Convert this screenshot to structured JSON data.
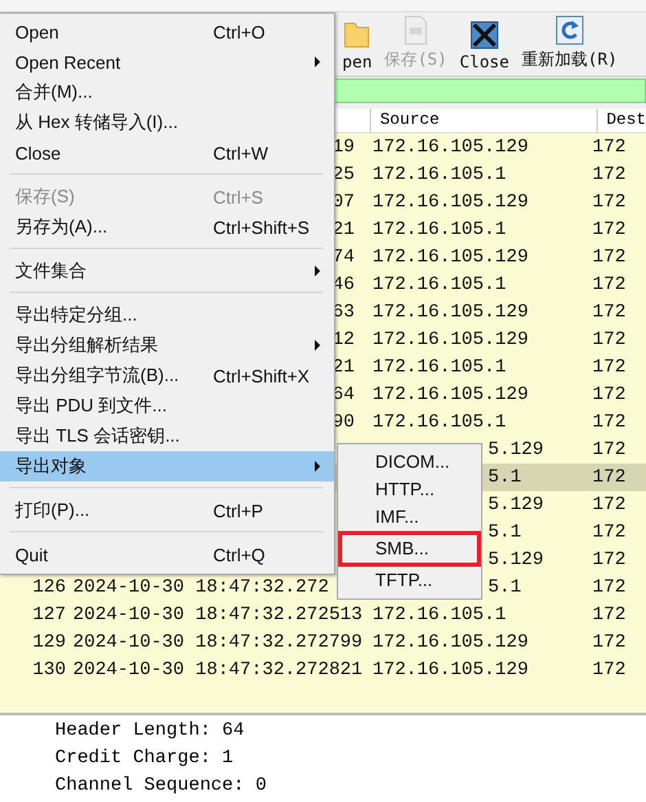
{
  "toolbar": {
    "buttons": [
      {
        "kind": "folder",
        "label": "pen",
        "disabled": false
      },
      {
        "kind": "save",
        "label": "保存(S)",
        "disabled": true
      },
      {
        "kind": "close",
        "label": "Close",
        "disabled": false
      },
      {
        "kind": "reload",
        "label": "重新加载(R)",
        "disabled": false
      }
    ]
  },
  "packet_list": {
    "columns": [
      "Source",
      "Dest"
    ],
    "rows": [
      {
        "kind": "tail",
        "time": "19",
        "source": "172.16.105.129",
        "destination": "172",
        "selected": false
      },
      {
        "kind": "tail",
        "time": "25",
        "source": "172.16.105.1",
        "destination": "172",
        "selected": false
      },
      {
        "kind": "tail",
        "time": "07",
        "source": "172.16.105.129",
        "destination": "172",
        "selected": false
      },
      {
        "kind": "tail",
        "time": "21",
        "source": "172.16.105.1",
        "destination": "172",
        "selected": false
      },
      {
        "kind": "tail",
        "time": "74",
        "source": "172.16.105.129",
        "destination": "172",
        "selected": false
      },
      {
        "kind": "tail",
        "time": "46",
        "source": "172.16.105.1",
        "destination": "172",
        "selected": false
      },
      {
        "kind": "tail",
        "time": "63",
        "source": "172.16.105.129",
        "destination": "172",
        "selected": false
      },
      {
        "kind": "tail",
        "time": "12",
        "source": "172.16.105.129",
        "destination": "172",
        "selected": false
      },
      {
        "kind": "tail",
        "time": "21",
        "source": "172.16.105.1",
        "destination": "172",
        "selected": false
      },
      {
        "kind": "tail",
        "time": "64",
        "source": "172.16.105.129",
        "destination": "172",
        "selected": false
      },
      {
        "kind": "tail",
        "time": "90",
        "source": "172.16.105.1",
        "destination": "172",
        "selected": false
      },
      {
        "kind": "covered",
        "source": "5.129",
        "destination": "172",
        "selected": false
      },
      {
        "kind": "covered",
        "source": "5.1",
        "destination": "172",
        "selected": true
      },
      {
        "kind": "covered",
        "source": "5.129",
        "destination": "172",
        "selected": false
      },
      {
        "kind": "covered",
        "source": "5.1",
        "destination": "172",
        "selected": false
      },
      {
        "kind": "covered",
        "source": "5.129",
        "destination": "172",
        "selected": false
      },
      {
        "kind": "partial",
        "number": "126",
        "time": "2024-10-30 18:47:32.272",
        "source": "5.1",
        "destination": "172",
        "selected": false
      },
      {
        "kind": "full",
        "number": "127",
        "time": "2024-10-30 18:47:32.272513",
        "source": "172.16.105.1",
        "destination": "172",
        "selected": false
      },
      {
        "kind": "full",
        "number": "129",
        "time": "2024-10-30 18:47:32.272799",
        "source": "172.16.105.129",
        "destination": "172",
        "selected": false
      },
      {
        "kind": "full",
        "number": "130",
        "time": "2024-10-30 18:47:32.272821",
        "source": "172.16.105.129",
        "destination": "172",
        "selected": false
      }
    ]
  },
  "details": {
    "lines": [
      "Header Length: 64",
      "Credit Charge: 1",
      "Channel Sequence: 0"
    ]
  },
  "file_menu": {
    "items": [
      {
        "kind": "item",
        "label": "Open",
        "shortcut": "Ctrl+O",
        "submenu": false,
        "disabled": false,
        "selected": false
      },
      {
        "kind": "item",
        "label": "Open Recent",
        "submenu": true,
        "disabled": false,
        "selected": false
      },
      {
        "kind": "item",
        "label": "合并(M)...",
        "submenu": false,
        "disabled": false,
        "selected": false
      },
      {
        "kind": "item",
        "label": "从 Hex 转储导入(I)...",
        "submenu": false,
        "disabled": false,
        "selected": false
      },
      {
        "kind": "item",
        "label": "Close",
        "shortcut": "Ctrl+W",
        "submenu": false,
        "disabled": false,
        "selected": false
      },
      {
        "kind": "separator"
      },
      {
        "kind": "item",
        "label": "保存(S)",
        "shortcut": "Ctrl+S",
        "submenu": false,
        "disabled": true,
        "selected": false
      },
      {
        "kind": "item",
        "label": "另存为(A)...",
        "shortcut": "Ctrl+Shift+S",
        "submenu": false,
        "disabled": false,
        "selected": false
      },
      {
        "kind": "separator"
      },
      {
        "kind": "item",
        "label": "文件集合",
        "submenu": true,
        "disabled": false,
        "selected": false
      },
      {
        "kind": "separator"
      },
      {
        "kind": "item",
        "label": "导出特定分组...",
        "submenu": false,
        "disabled": false,
        "selected": false
      },
      {
        "kind": "item",
        "label": "导出分组解析结果",
        "submenu": true,
        "disabled": false,
        "selected": false
      },
      {
        "kind": "item",
        "label": "导出分组字节流(B)...",
        "shortcut": "Ctrl+Shift+X",
        "submenu": false,
        "disabled": false,
        "selected": false
      },
      {
        "kind": "item",
        "label": "导出 PDU 到文件...",
        "submenu": false,
        "disabled": false,
        "selected": false
      },
      {
        "kind": "item",
        "label": "导出 TLS 会话密钥...",
        "submenu": false,
        "disabled": false,
        "selected": false
      },
      {
        "kind": "item",
        "label": "导出对象",
        "submenu": true,
        "disabled": false,
        "selected": true
      },
      {
        "kind": "separator"
      },
      {
        "kind": "item",
        "label": "打印(P)...",
        "shortcut": "Ctrl+P",
        "submenu": false,
        "disabled": false,
        "selected": false
      },
      {
        "kind": "separator"
      },
      {
        "kind": "item",
        "label": "Quit",
        "shortcut": "Ctrl+Q",
        "submenu": false,
        "disabled": false,
        "selected": false
      }
    ]
  },
  "export_submenu": {
    "items": [
      {
        "label": "DICOM...",
        "highlighted": false
      },
      {
        "label": "HTTP...",
        "highlighted": false
      },
      {
        "label": "IMF...",
        "highlighted": false
      },
      {
        "label": "SMB...",
        "highlighted": true
      },
      {
        "label": "TFTP...",
        "highlighted": false
      }
    ]
  }
}
